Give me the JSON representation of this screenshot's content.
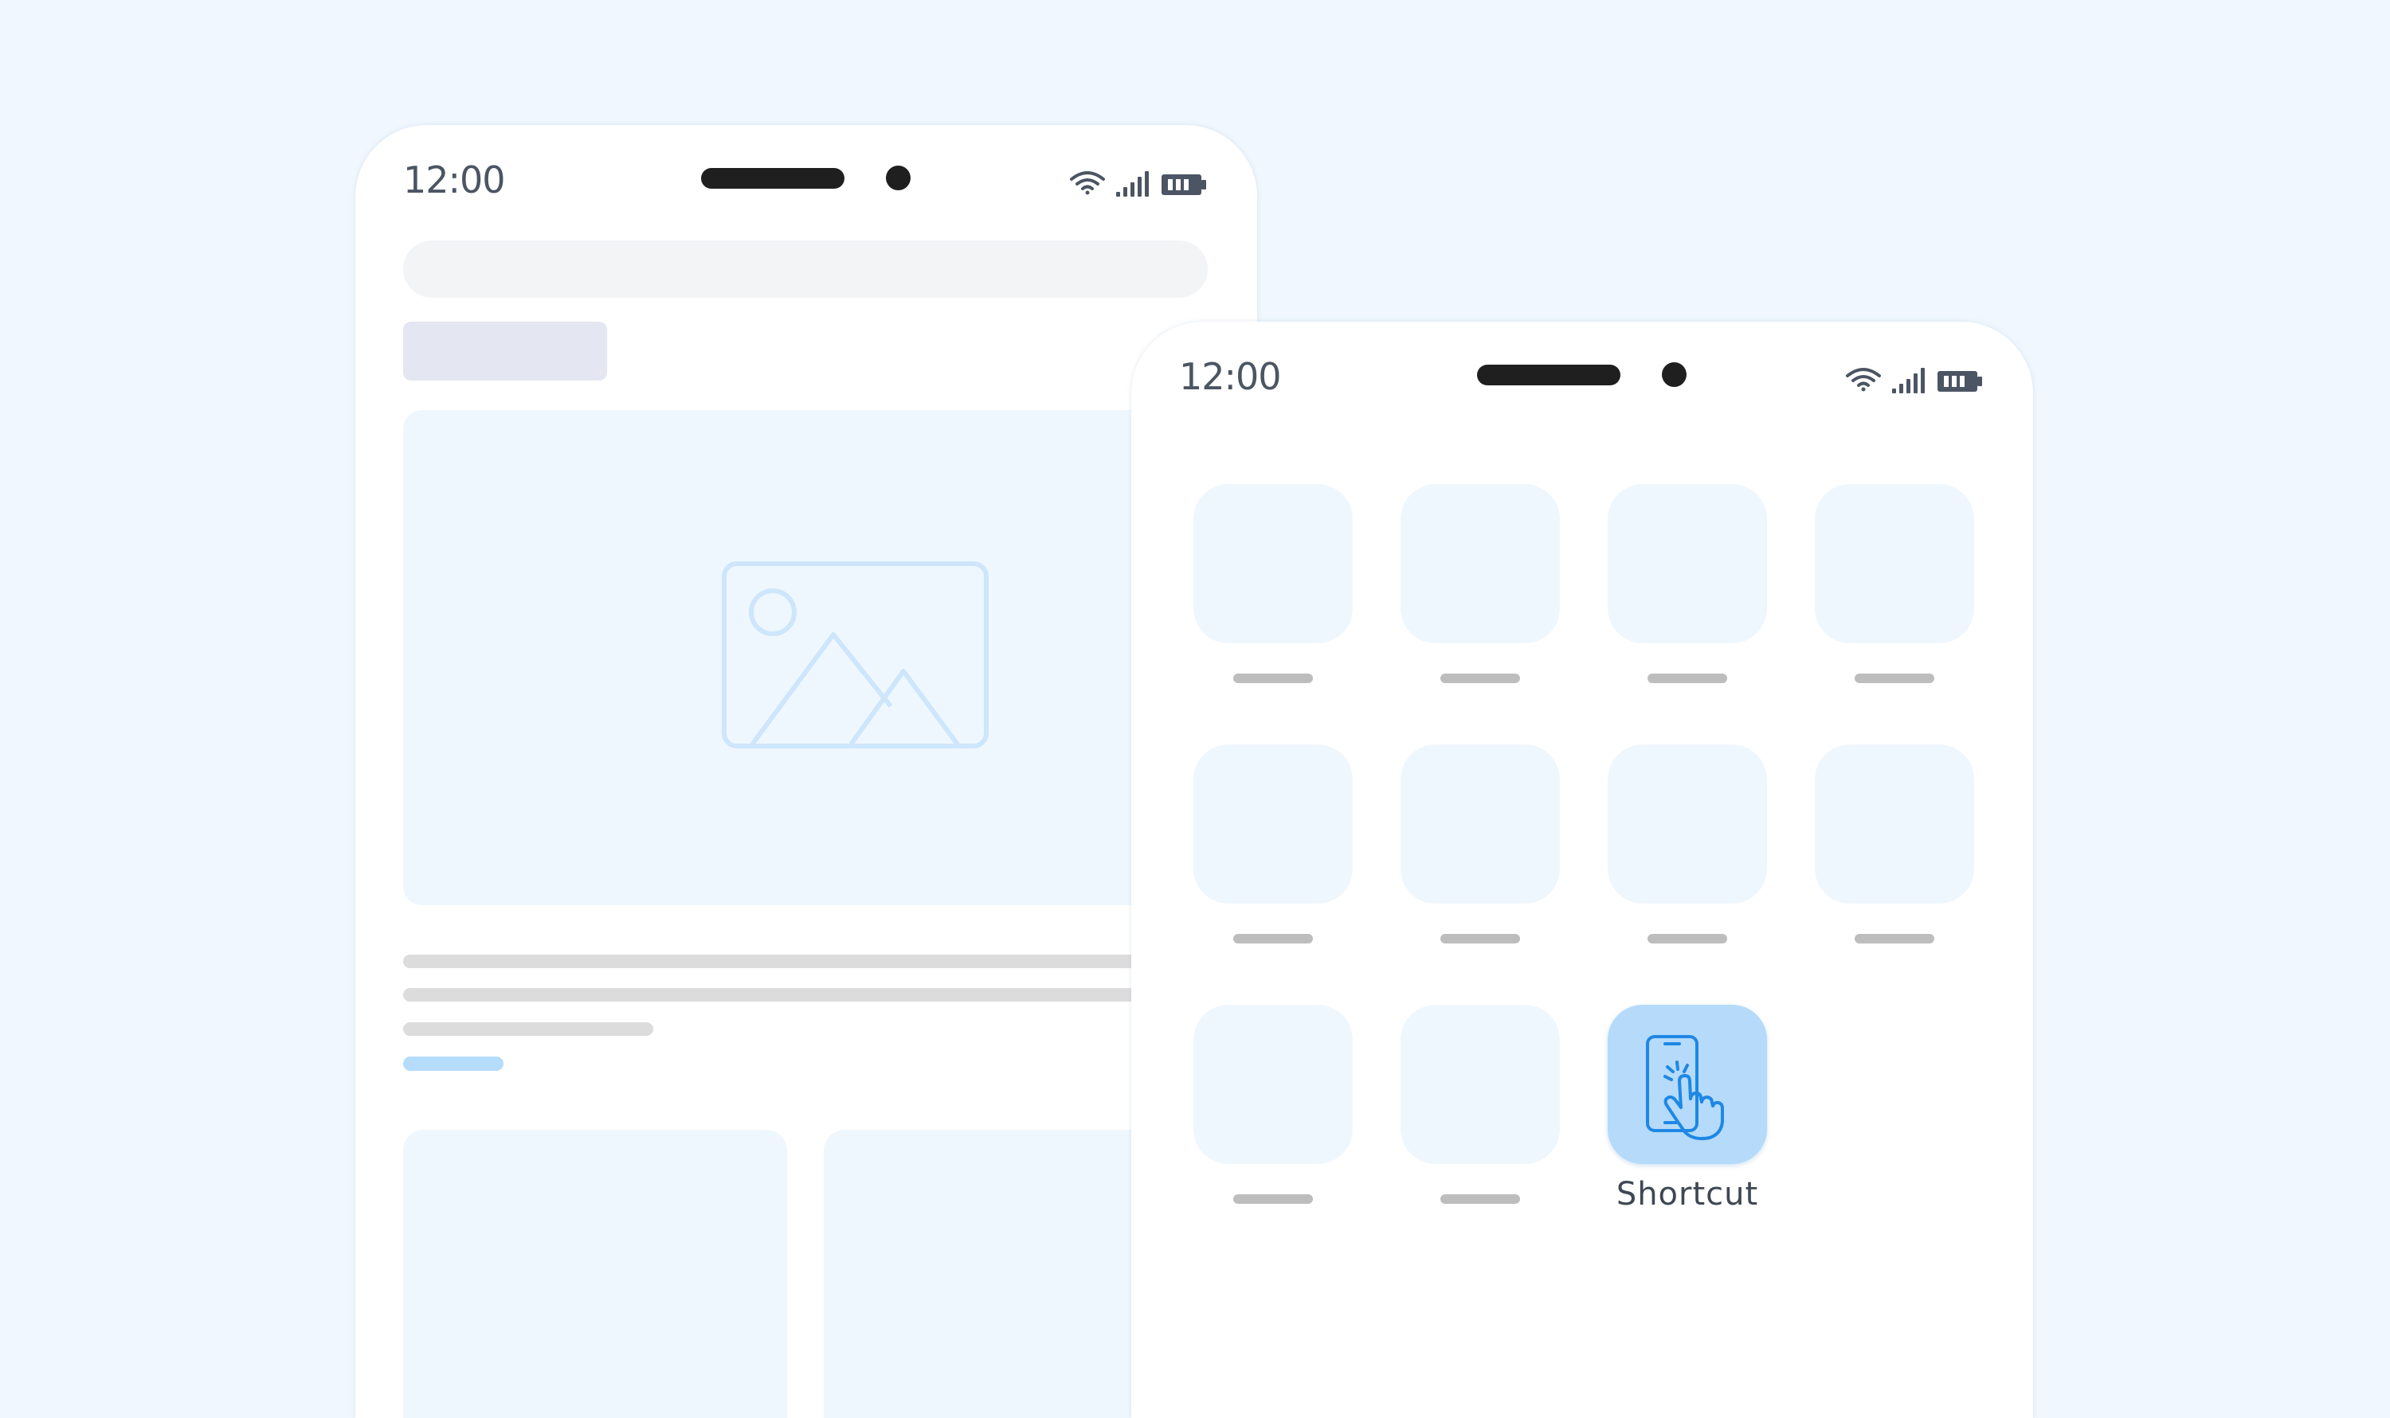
{
  "status_bar": {
    "time": "12:00",
    "icons": [
      "wifi-icon",
      "signal-icon",
      "battery-icon"
    ]
  },
  "back_screen": {
    "image_placeholder_icon": "image-icon"
  },
  "home_screen": {
    "apps": [
      {
        "label": ""
      },
      {
        "label": ""
      },
      {
        "label": ""
      },
      {
        "label": ""
      },
      {
        "label": ""
      },
      {
        "label": ""
      },
      {
        "label": ""
      },
      {
        "label": ""
      },
      {
        "label": ""
      },
      {
        "label": ""
      },
      {
        "label": "Shortcut",
        "icon": "phone-tap-icon",
        "highlighted": true
      }
    ]
  },
  "colors": {
    "background": "#f0f7fe",
    "placeholder_tile": "#eff7fe",
    "shortcut_tile": "#b5dafa",
    "shortcut_icon": "#1e88e5",
    "text": "#3f4753"
  }
}
